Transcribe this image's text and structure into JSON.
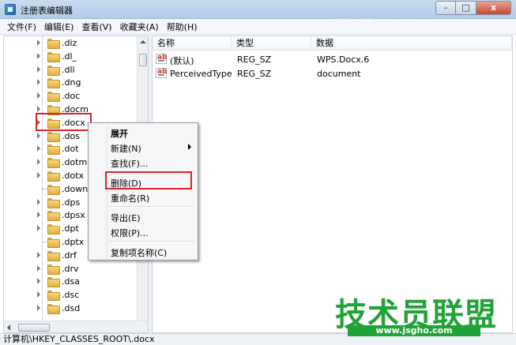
{
  "window": {
    "title": "注册表编辑器",
    "watermark": "三联网 3LIAN.COM",
    "controls": {
      "minimize": "–",
      "maximize": "□",
      "close": "x"
    }
  },
  "menu": [
    "文件(F)",
    "编辑(E)",
    "查看(V)",
    "收藏夹(A)",
    "帮助(H)"
  ],
  "tree": {
    "items": [
      {
        "label": ".diz",
        "expandable": true
      },
      {
        "label": ".dl_",
        "expandable": true
      },
      {
        "label": ".dll",
        "expandable": true
      },
      {
        "label": ".dng",
        "expandable": true
      },
      {
        "label": ".doc",
        "expandable": true
      },
      {
        "label": ".docm",
        "expandable": true
      },
      {
        "label": ".docx",
        "expandable": true,
        "selected": true
      },
      {
        "label": ".dos",
        "expandable": true
      },
      {
        "label": ".dot",
        "expandable": true
      },
      {
        "label": ".dotm",
        "expandable": true
      },
      {
        "label": ".dotx",
        "expandable": true
      },
      {
        "label": ".downli",
        "expandable": false
      },
      {
        "label": ".dps",
        "expandable": true
      },
      {
        "label": ".dpsx",
        "expandable": true
      },
      {
        "label": ".dpt",
        "expandable": true
      },
      {
        "label": ".dptx",
        "expandable": false
      },
      {
        "label": ".drf",
        "expandable": true
      },
      {
        "label": ".drv",
        "expandable": true
      },
      {
        "label": ".dsa",
        "expandable": true
      },
      {
        "label": ".dsc",
        "expandable": true
      },
      {
        "label": ".dsd",
        "expandable": true
      }
    ]
  },
  "values": {
    "columns": [
      "名称",
      "类型",
      "数据"
    ],
    "rows": [
      {
        "name": "(默认)",
        "type": "REG_SZ",
        "data": "WPS.Docx.6"
      },
      {
        "name": "PerceivedType",
        "type": "REG_SZ",
        "data": "document"
      }
    ]
  },
  "context_menu": {
    "items": [
      {
        "label": "展开",
        "bold": true
      },
      {
        "label": "新建(N)",
        "submenu": true
      },
      {
        "label": "查找(F)..."
      },
      {
        "label": "删除(D)",
        "highlighted": true
      },
      {
        "label": "重命名(R)"
      },
      {
        "label": "导出(E)"
      },
      {
        "label": "权限(P)..."
      },
      {
        "label": "复制项名称(C)"
      }
    ]
  },
  "status": "计算机\\HKEY_CLASSES_ROOT\\.docx",
  "brand": {
    "main": "技术员联盟",
    "url": "www.jsgho.com"
  }
}
